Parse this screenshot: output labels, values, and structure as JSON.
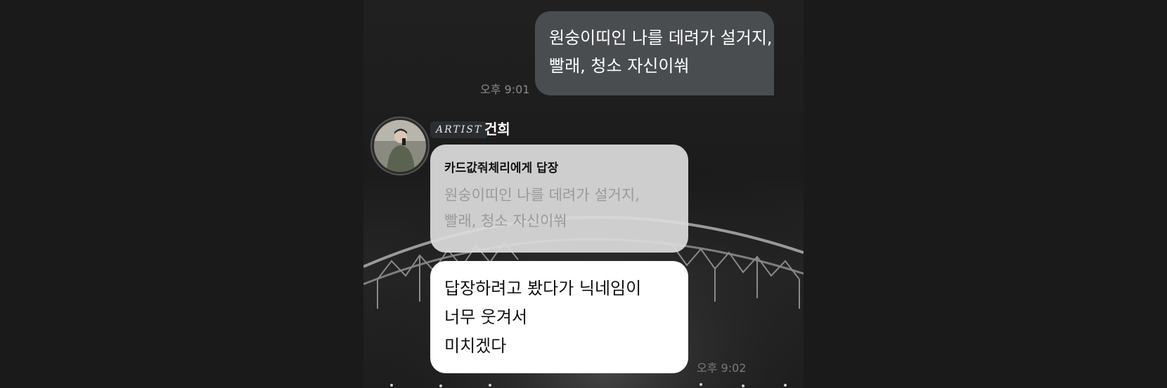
{
  "outgoing_message": {
    "lines": [
      "원숭이띠인 나를 데려가 설거지,",
      "빨래, 청소 자신이쒀"
    ],
    "time": "오후 9:01"
  },
  "incoming_message": {
    "badge": "ARTIST",
    "sender": "건희",
    "reply": {
      "title": "카드값줘체리에게 답장",
      "quoted_lines": [
        "원숭이띠인 나를 데려가 설거지,",
        "빨래, 청소 자신이쒀"
      ]
    },
    "lines": [
      "답장하려고 봤다가 닉네임이",
      "너무 웃겨서",
      "미치겠다"
    ],
    "time": "오후 9:02"
  },
  "colors": {
    "page_bg": "#1a1a1a",
    "outgoing_bubble": "#4a4d50",
    "reply_bubble": "#dcdcdc",
    "incoming_bubble": "#ffffff",
    "badge_bg": "#2b2e31"
  },
  "icons": {
    "avatar": "person-photo-avatar"
  }
}
